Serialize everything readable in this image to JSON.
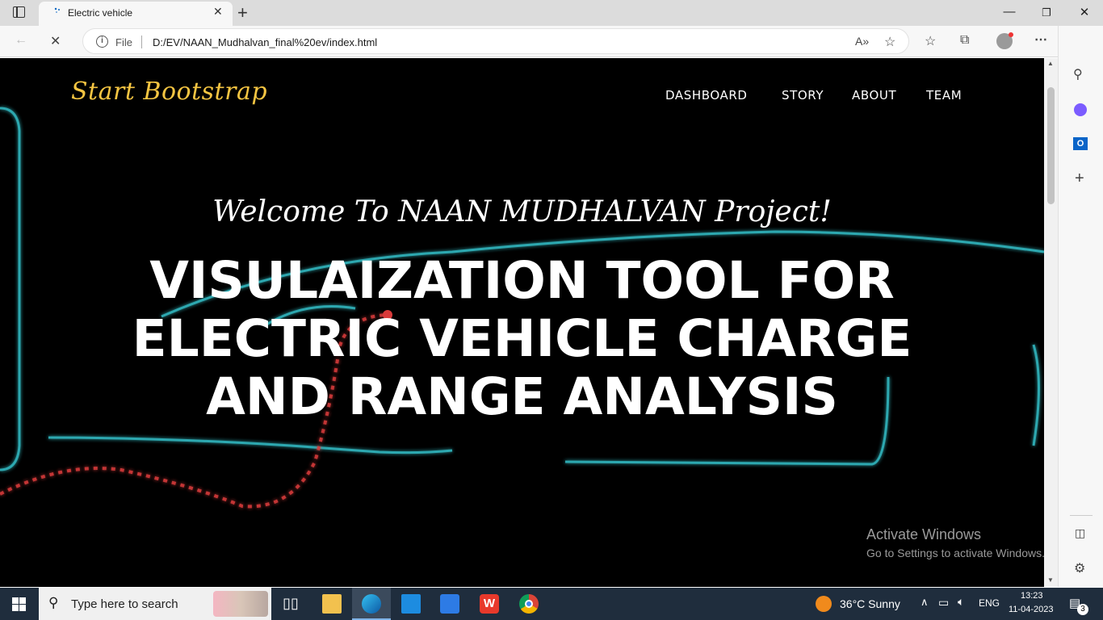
{
  "browser": {
    "tab_title": "Electric vehicle",
    "address_scheme": "File",
    "url": "D:/EV/NAAN_Mudhalvan_final%20ev/index.html"
  },
  "site": {
    "brand": "Start Bootstrap",
    "nav": [
      "DASHBOARD",
      "STORY",
      "ABOUT",
      "TEAM"
    ],
    "welcome": "Welcome To NAAN MUDHALVAN Project!",
    "headline_lines": [
      "VISULAIZATION TOOL FOR",
      "ELECTRIC VEHICLE CHARGE",
      "AND RANGE ANALYSIS"
    ]
  },
  "watermark": {
    "title": "Activate Windows",
    "subtitle": "Go to Settings to activate Windows."
  },
  "taskbar": {
    "search_placeholder": "Type here to search",
    "weather": "36°C  Sunny",
    "language": "ENG",
    "time": "13:23",
    "date": "11-04-2023",
    "notification_count": "3"
  },
  "colors": {
    "brand": "#f5c542",
    "page_bg": "#000000",
    "taskbar": "#1f2d3d",
    "neon_cyan": "#36c6cf",
    "neon_red": "#d93a3a"
  }
}
